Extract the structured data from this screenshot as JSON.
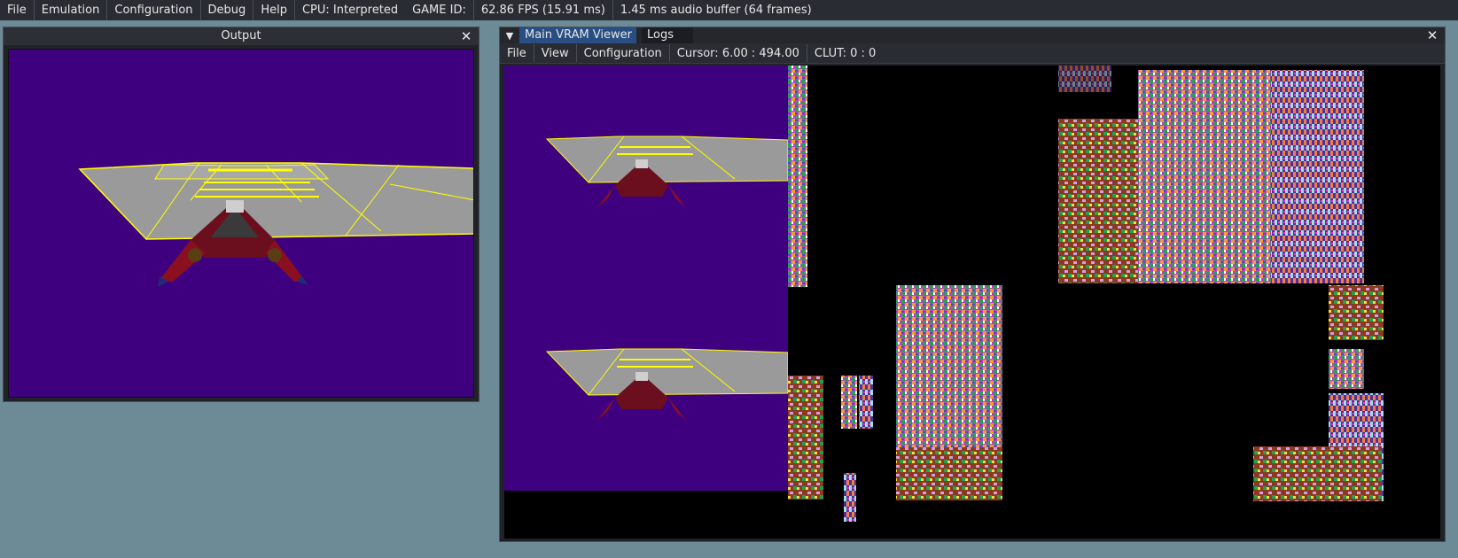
{
  "menubar": {
    "items": [
      "File",
      "Emulation",
      "Configuration",
      "Debug",
      "Help"
    ],
    "cpu": "CPU: Interpreted",
    "game_id": "GAME ID:",
    "fps": "62.86 FPS (15.91 ms)",
    "audio": "1.45 ms audio buffer (64 frames)"
  },
  "output_window": {
    "title": "Output"
  },
  "vram_window": {
    "tabs": [
      "Main VRAM Viewer",
      "Logs"
    ],
    "menu": [
      "File",
      "View",
      "Configuration"
    ],
    "cursor": "Cursor: 6.00 : 494.00",
    "clut": "CLUT: 0 : 0"
  },
  "colors": {
    "background": "#6d8b96",
    "game_bg": "#3f0080",
    "track": "#9a9a9a",
    "track_lines": "#ffff00",
    "active_tab": "#294e83"
  },
  "icons": {
    "close": "close-icon",
    "tab_menu": "tab-menu-icon"
  }
}
